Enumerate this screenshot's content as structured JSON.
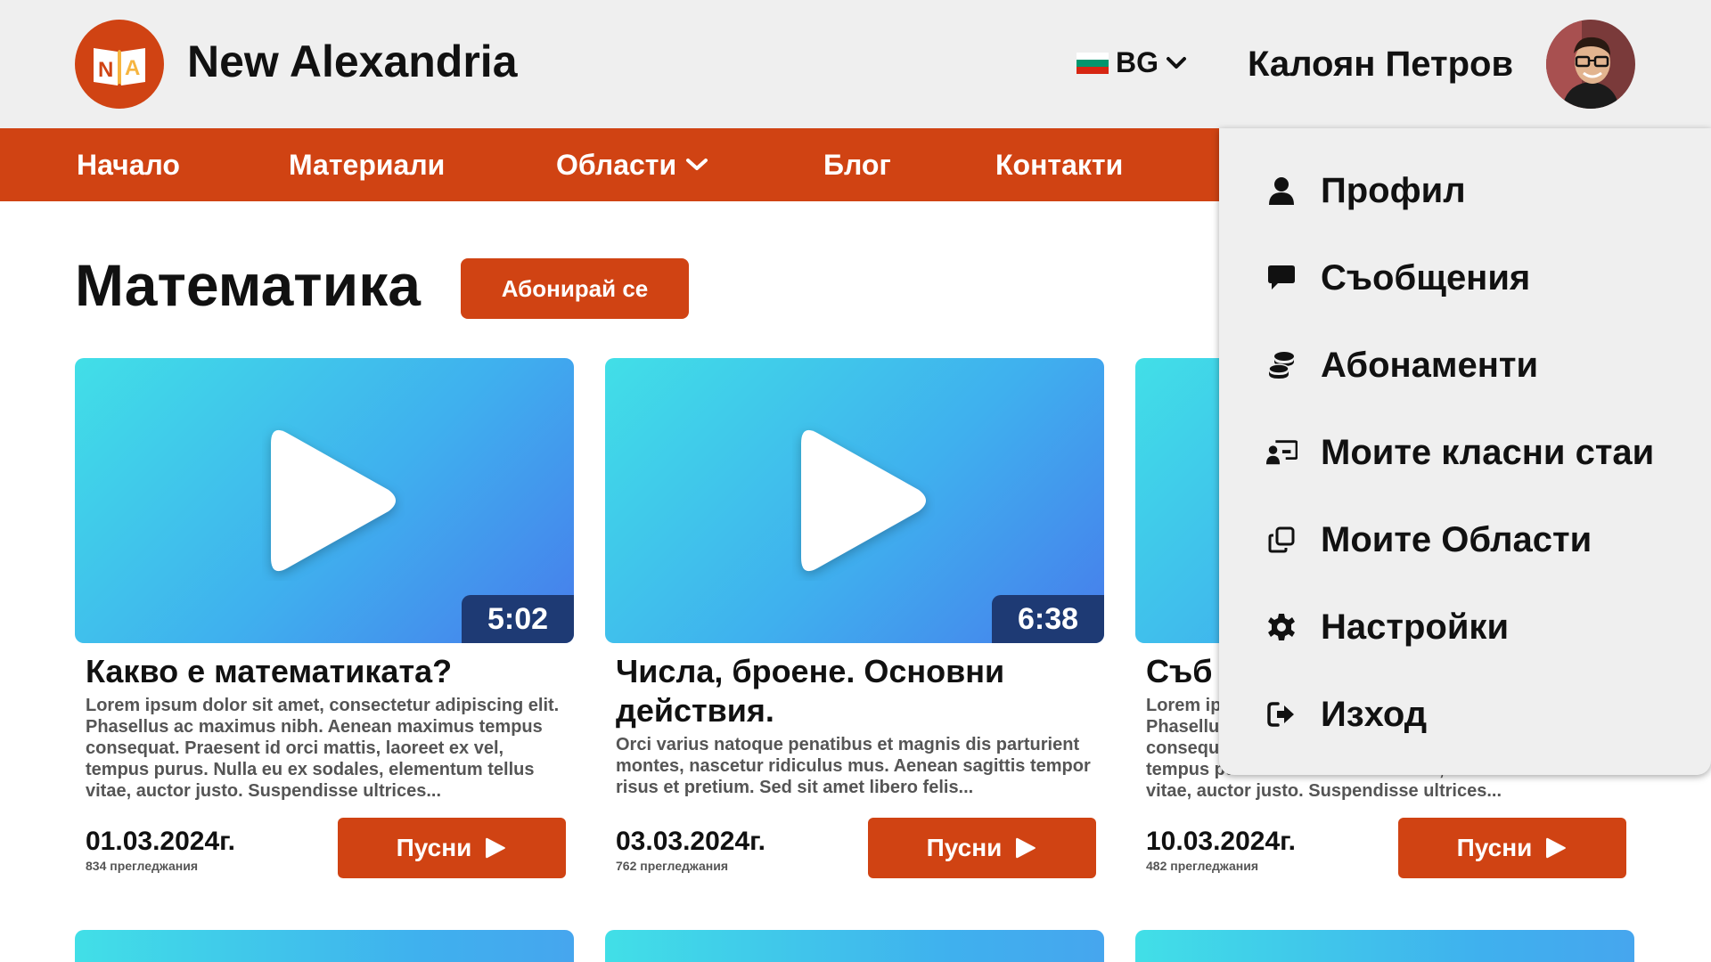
{
  "header": {
    "brand": "New Alexandria",
    "logo_text": "NA",
    "language": "BG",
    "user_name": "Калоян Петров"
  },
  "nav": {
    "items": [
      {
        "label": "Начало"
      },
      {
        "label": "Материали"
      },
      {
        "label": "Области"
      },
      {
        "label": "Блог"
      },
      {
        "label": "Контакти"
      }
    ]
  },
  "page": {
    "title": "Математика",
    "subscribe_label": "Абонирай се"
  },
  "videos": [
    {
      "title": "Какво е математиката?",
      "description": "Lorem ipsum dolor sit amet, consectetur adipiscing elit. Phasellus ac maximus nibh. Aenean maximus tempus consequat. Praesent id orci mattis, laoreet ex vel, tempus purus. Nulla eu ex sodales, elementum tellus vitae, auctor justo. Suspendisse ultrices...",
      "duration": "5:02",
      "date": "01.03.2024г.",
      "views": "834 прегледжания",
      "play_label": "Пусни"
    },
    {
      "title": "Числа, броене. Основни действия.",
      "description": "Orci varius natoque penatibus et magnis dis parturient montes, nascetur ridiculus mus. Aenean sagittis tempor risus et pretium. Sed sit amet libero felis...",
      "duration": "6:38",
      "date": "03.03.2024г.",
      "views": "762 прегледжания",
      "play_label": "Пусни"
    },
    {
      "title": "Съб",
      "description": "Lorem ipsum dolor sit amet, consectetur adipiscing elit. Phasellus ac maximus nibh. Aenean maximus tempus consequat. Praesent id orci mattis, laoreet ex vel, tempus purus. Nulla eu ex sodales, elementum tellus vitae, auctor justo. Suspendisse ultrices...",
      "duration": "",
      "date": "10.03.2024г.",
      "views": "482 прегледжания",
      "play_label": "Пусни"
    }
  ],
  "user_menu": {
    "items": [
      {
        "label": "Профил",
        "icon": "user-icon"
      },
      {
        "label": "Съобщения",
        "icon": "message-icon"
      },
      {
        "label": "Абонаменти",
        "icon": "coins-icon"
      },
      {
        "label": "Моите класни стаи",
        "icon": "classroom-icon"
      },
      {
        "label": "Моите Области",
        "icon": "clone-icon"
      },
      {
        "label": "Настройки",
        "icon": "gear-icon"
      },
      {
        "label": "Изход",
        "icon": "logout-icon"
      }
    ]
  },
  "colors": {
    "accent": "#d04313",
    "header_bg": "#efefef",
    "duration_bg": "#1e3a74",
    "flag": [
      "#ffffff",
      "#00966e",
      "#d62612"
    ]
  }
}
